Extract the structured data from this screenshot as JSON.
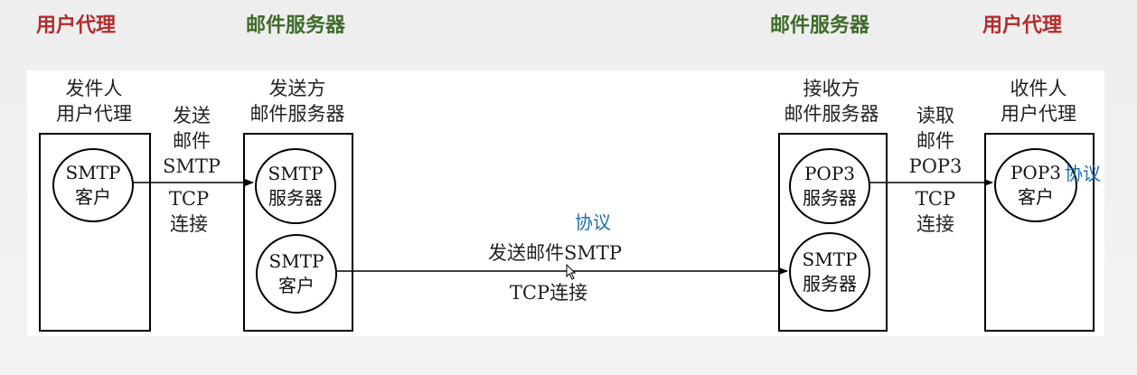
{
  "headers": {
    "left_agent": "用户代理",
    "left_server": "邮件服务器",
    "right_server": "邮件服务器",
    "right_agent": "用户代理"
  },
  "colors": {
    "agent": "#b32c2c",
    "server": "#3f6b2a",
    "annotation": "#1e6fb8"
  },
  "nodes": {
    "sender_agent": "发件人\n用户代理",
    "sender_server": "发送方\n邮件服务器",
    "receiver_server": "接收方\n邮件服务器",
    "receiver_agent": "收件人\n用户代理"
  },
  "circles": {
    "smtp_client_1": "SMTP\n客户",
    "smtp_server_1": "SMTP\n服务器",
    "smtp_client_2": "SMTP\n客户",
    "pop3_server": "POP3\n服务器",
    "smtp_server_2": "SMTP\n服务器",
    "pop3_client": "POP3\n客户"
  },
  "links": {
    "send_label": "发送\n邮件\nSMTP",
    "send_tcp": "TCP\n连接",
    "middle_send": "发送邮件SMTP",
    "middle_tcp": "TCP连接",
    "read_label": "读取\n邮件\nPOP3",
    "read_tcp": "TCP\n连接"
  },
  "annotations": {
    "middle": "协议",
    "right": "协议"
  }
}
